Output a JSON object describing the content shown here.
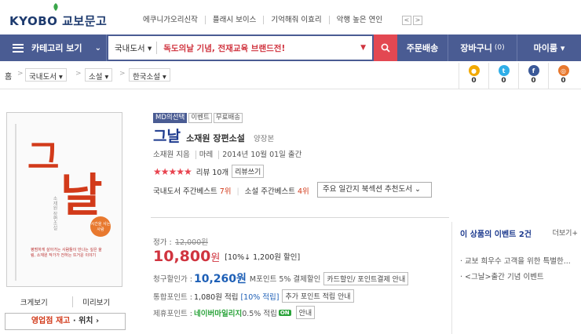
{
  "header": {
    "logo_text": "KYOBO 교보문고",
    "links": [
      "에쿠니가오리신작",
      "플래시 보이스",
      "기억해줘 이효리",
      "악행 높은 연인"
    ],
    "prev_label": "<",
    "next_label": ">"
  },
  "nav": {
    "category_label": "카테고리 보기",
    "search_scope": "국내도서 ▾",
    "search_query": "독도의날 기념, 전재교육 브랜드전!",
    "order_label": "주문배송",
    "cart_label": "장바구니",
    "cart_count": "(0)",
    "my_label": "마이룸 ▾"
  },
  "breadcrumb": {
    "home": "홈",
    "items": [
      "국내도서 ▾",
      "소설 ▾",
      "한국소설 ▾"
    ],
    "sep": ">"
  },
  "share": {
    "items": [
      {
        "icon": "kakaostory-icon",
        "count": "0",
        "color": "#f2a900"
      },
      {
        "icon": "twitter-icon",
        "count": "0",
        "color": "#2faee8"
      },
      {
        "icon": "facebook-icon",
        "count": "0",
        "color": "#3b5998"
      },
      {
        "icon": "circle-share-icon",
        "count": "0",
        "color": "#e8792f"
      }
    ]
  },
  "book_cover": {
    "badge": "시간을 사는 사람",
    "blurb": "평범하게 살아가는 사람들이 만나는 깊은 울림, 소재원 작가가 전하는 뜨거운 이야기"
  },
  "product": {
    "tags": [
      "MD의선택",
      "이벤트",
      "무료배송"
    ],
    "title": "그날",
    "subtitle": "소재원 장편소설",
    "author_sub": "양장본",
    "meta": [
      "소재원 지음",
      "마레",
      "2014년 10월 01일 출간"
    ],
    "stars": "★★★★★",
    "review_count": "리뷰 10개",
    "write_review": "리뷰쓰기",
    "best_weekly": "국내도서 주간베스트",
    "best_weekly_rank": "7위",
    "best_novel": "소설 주간베스트",
    "best_novel_rank": "4위",
    "recommend_dropdown": "주요 일간지 북섹션 추천도서"
  },
  "pricing": {
    "list_label": "정가 :",
    "list_price": "12,000원",
    "sale_price": "10,800",
    "sale_unit": "원",
    "sale_discount": "[10%↓ 1,200원 할인]",
    "card_label": "청구할인가 :",
    "card_price": "10,260원",
    "card_note": "M포인트 5% 결제할인",
    "card_btn": "카드할인/ 포인트결제 안내",
    "point_label": "통합포인트 :",
    "point_value": "1,080원 적립",
    "point_rate": "[10% 적립]",
    "point_btn": "추가 포인트 적립 안내",
    "partner_label": "제휴포인트 :",
    "partner_name": "네이버마일리지",
    "partner_rate": "0.5% 적립",
    "partner_on": "ON",
    "partner_btn": "안내"
  },
  "events": {
    "header": "이 상품의 이벤트 2건",
    "more": "더보기+",
    "items": [
      "· 교보 희우수 고객을 위한 특별한...",
      "· <그날>출간 기념 이벤트"
    ]
  },
  "cover_actions": {
    "zoom": "크게보기",
    "preview": "미리보기",
    "stock_red": "영업점 재고",
    "stock_rest": "· 위치 ›"
  }
}
